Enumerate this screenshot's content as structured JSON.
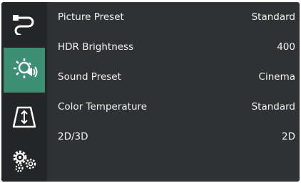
{
  "sidebar": {
    "items": [
      {
        "icon": "cable-icon",
        "active": false
      },
      {
        "icon": "picture-settings-icon",
        "active": true
      },
      {
        "icon": "keystone-icon",
        "active": false
      },
      {
        "icon": "gears-icon",
        "active": false
      }
    ]
  },
  "menu": {
    "rows": [
      {
        "label": "Picture Preset",
        "value": "Standard"
      },
      {
        "label": "HDR Brightness",
        "value": "400"
      },
      {
        "label": "Sound Preset",
        "value": "Cinema"
      },
      {
        "label": "Color Temperature",
        "value": "Standard"
      },
      {
        "label": "2D/3D",
        "value": "2D"
      }
    ]
  },
  "colors": {
    "panel": "#2f3133",
    "sidebar": "#232526",
    "accent": "#3d8f73",
    "text": "#f2f2f2"
  }
}
